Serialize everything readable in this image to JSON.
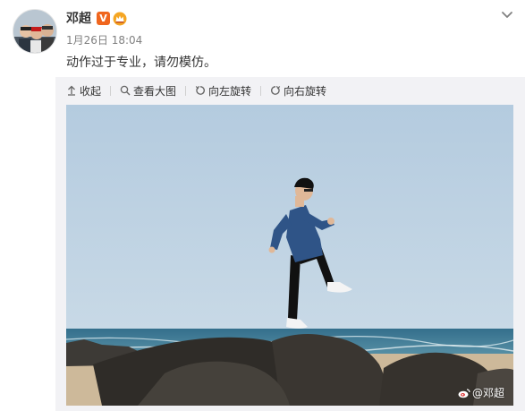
{
  "post": {
    "username": "邓超",
    "verified_badge": "V",
    "timestamp": "1月26日 18:04",
    "text": "动作过于专业，请勿模仿。"
  },
  "toolbar": {
    "collapse": "收起",
    "view_large": "查看大图",
    "rotate_left": "向左旋转",
    "rotate_right": "向右旋转"
  },
  "photo": {
    "watermark": "@邓超"
  },
  "icons": {
    "menu": "chevron-down-icon",
    "collapse": "arrow-up-icon",
    "view_large": "magnifier-icon",
    "rotate_left": "rotate-left-icon",
    "rotate_right": "rotate-right-icon",
    "watermark": "weibo-logo-icon",
    "crown": "crown-badge-icon"
  },
  "colors": {
    "badge": "#f0661e",
    "crown": "#f5a623",
    "sky": "#b7cde0",
    "sea": "#3f7e99"
  }
}
